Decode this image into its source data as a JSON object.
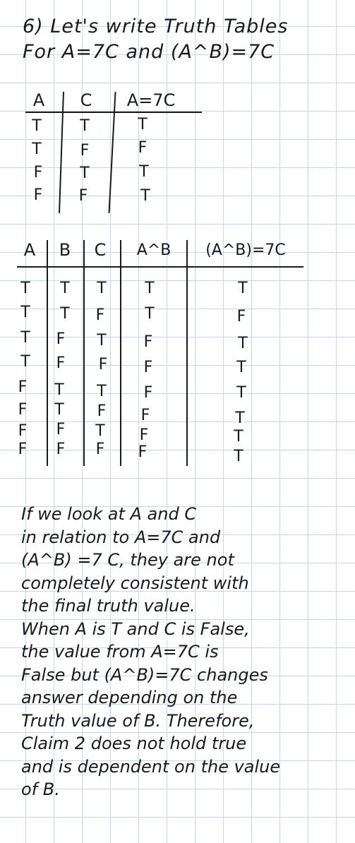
{
  "heading": {
    "line1": "6) Let's write Truth Tables",
    "line2": "For A=7C and (A^B)=7C"
  },
  "table1": {
    "headers": [
      "A",
      "C",
      "A=7C"
    ],
    "rows": [
      [
        "T",
        "T",
        "T"
      ],
      [
        "T",
        "F",
        "F"
      ],
      [
        "F",
        "T",
        "T"
      ],
      [
        "F",
        "F",
        "T"
      ]
    ]
  },
  "table2": {
    "headers": [
      "A",
      "B",
      "C",
      "A^B",
      "(A^B)=7C"
    ],
    "rows": [
      [
        "T",
        "T",
        "T",
        "T",
        "T"
      ],
      [
        "T",
        "T",
        "F",
        "T",
        "F"
      ],
      [
        "T",
        "F",
        "T",
        "F",
        "T"
      ],
      [
        "T",
        "F",
        "F",
        "F",
        "T"
      ],
      [
        "F",
        "T",
        "T",
        "F",
        "T"
      ],
      [
        "F",
        "T",
        "F",
        "F",
        "T"
      ],
      [
        "F",
        "F",
        "T",
        "F",
        "T"
      ],
      [
        "F",
        "F",
        "F",
        "F",
        "T"
      ]
    ]
  },
  "paragraph": [
    "If we look at A and C",
    "in relation to A=7C and",
    "(A^B) =7 C, they are not",
    "completely consistent with",
    "the final truth value.",
    "When A is T and C is False,",
    "the value from A=7C is",
    "False but (A^B)=7C changes",
    "answer depending on the",
    "Truth value of B. Therefore,",
    "Claim 2 does not hold true",
    "and is dependent on the value",
    "of B."
  ]
}
